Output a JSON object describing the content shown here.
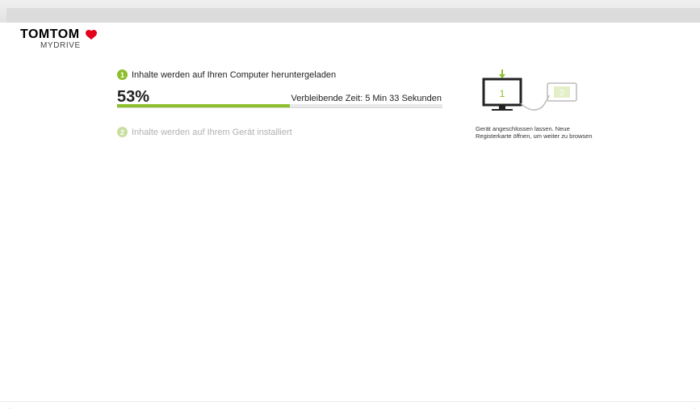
{
  "logo": {
    "main": "TOMTOM",
    "sub": "MYDRIVE"
  },
  "steps": [
    {
      "number": "1",
      "label": "Inhalte werden auf Ihren Computer heruntergeladen"
    },
    {
      "number": "2",
      "label": "Inhalte werden auf Ihrem Gerät installiert"
    }
  ],
  "progress": {
    "percent_label": "53%",
    "value": 0.53,
    "time_label": "Verbleibende Zeit: 5 Min 33 Sekunden"
  },
  "illustration": {
    "screen1_number": "1",
    "screen2_number": "2"
  },
  "status": {
    "line1": "Gerät angeschlossen lassen. Neue",
    "line2": "Registerkarte öffnen, um weiter zu browsen"
  },
  "colors": {
    "accent": "#8dbf2a",
    "accent_light": "#c8dea0",
    "logo_red": "#e2001a"
  }
}
